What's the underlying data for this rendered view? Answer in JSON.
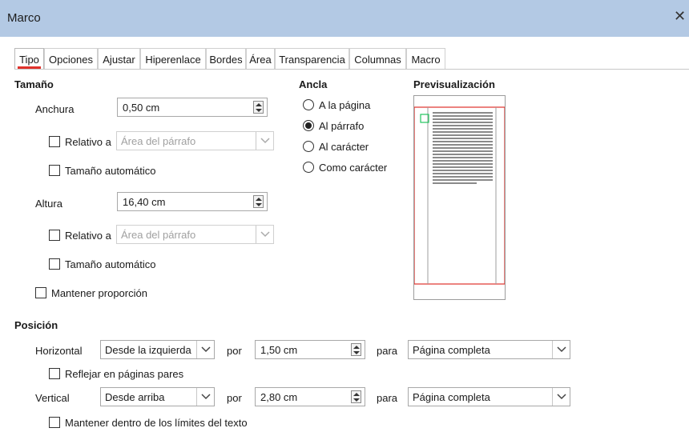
{
  "window": {
    "title": "Marco",
    "close_glyph": "✕"
  },
  "tabs": [
    {
      "label": "Tipo",
      "active": true
    },
    {
      "label": "Opciones"
    },
    {
      "label": "Ajustar"
    },
    {
      "label": "Hiperenlace"
    },
    {
      "label": "Bordes"
    },
    {
      "label": "Área"
    },
    {
      "label": "Transparencia"
    },
    {
      "label": "Columnas"
    },
    {
      "label": "Macro"
    }
  ],
  "size": {
    "heading": "Tamaño",
    "width_label": "Anchura",
    "width_value": "0,50 cm",
    "width_relative_label": "Relativo a",
    "width_relative_value": "Área del párrafo",
    "width_auto_label": "Tamaño automático",
    "height_label": "Altura",
    "height_value": "16,40 cm",
    "height_relative_label": "Relativo a",
    "height_relative_value": "Área del párrafo",
    "height_auto_label": "Tamaño automático",
    "keep_ratio_label": "Mantener proporción"
  },
  "anchor": {
    "heading": "Ancla",
    "options": [
      {
        "label": "A la página",
        "selected": false
      },
      {
        "label": "Al párrafo",
        "selected": true
      },
      {
        "label": "Al carácter",
        "selected": false
      },
      {
        "label": "Como carácter",
        "selected": false
      }
    ]
  },
  "preview": {
    "heading": "Previsualización"
  },
  "position": {
    "heading": "Posición",
    "horizontal_label": "Horizontal",
    "horizontal_value": "Desde la izquierda",
    "horizontal_by_label": "por",
    "horizontal_by_value": "1,50 cm",
    "horizontal_to_label": "para",
    "horizontal_to_value": "Página completa",
    "mirror_label": "Reflejar en páginas pares",
    "vertical_label": "Vertical",
    "vertical_value": "Desde arriba",
    "vertical_by_label": "por",
    "vertical_by_value": "2,80 cm",
    "vertical_to_label": "para",
    "vertical_to_value": "Página completa",
    "keep_inside_label": "Mantener dentro de los límites del texto"
  },
  "colors": {
    "titlebar": "#b3c9e4",
    "active_tab_accent": "#e0312b",
    "preview_frame": "#e0312b",
    "preview_marker": "#22c55e"
  }
}
